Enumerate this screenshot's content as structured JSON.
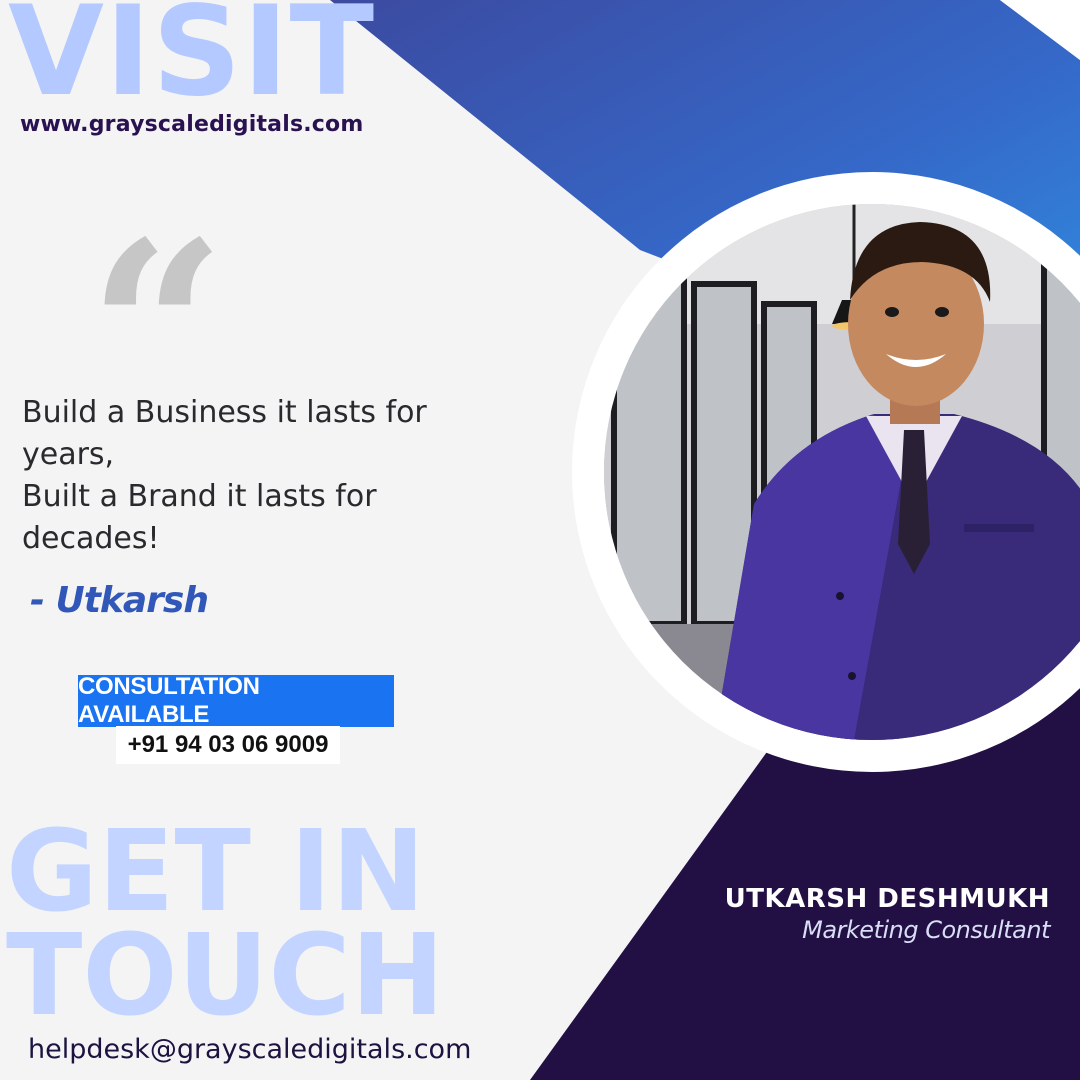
{
  "visit": "VISIT",
  "website": "www.grayscaledigitals.com",
  "quote_mark": "“",
  "quote_lines": [
    "Build a Business it lasts for",
    "years,",
    "Built a Brand it lasts for",
    "decades!"
  ],
  "author": "- Utkarsh",
  "consultation": "CONSULTATION AVAILABLE",
  "phone": "+91 94 03 06 9009",
  "cta_lines": [
    "GET IN",
    "TOUCH"
  ],
  "email": "helpdesk@grayscaledigitals.com",
  "person": {
    "name": "UTKARSH DESHMUKH",
    "title": "Marketing Consultant"
  },
  "colors": {
    "light_bg": "#f4f4f5",
    "blue_top": "#3a4fa8",
    "blue_mid": "#2f8ee0",
    "dark_purple": "#221045",
    "accent_blue": "#1a73f0",
    "headline_light": "#b4c9ff"
  }
}
